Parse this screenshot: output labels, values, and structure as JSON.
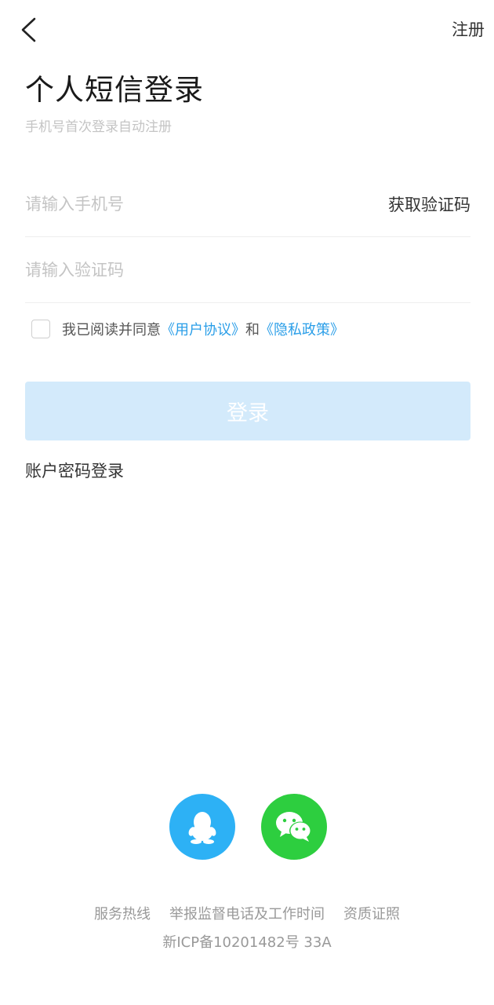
{
  "header": {
    "back_icon": "chevron-left-icon",
    "register_label": "注册"
  },
  "title": "个人短信登录",
  "subtitle": "手机号首次登录自动注册",
  "phone": {
    "placeholder": "请输入手机号",
    "value": "",
    "get_code_label": "获取验证码"
  },
  "code": {
    "placeholder": "请输入验证码",
    "value": ""
  },
  "agreement": {
    "checked": false,
    "prefix": "我已阅读并同意",
    "user_agreement": "《用户协议》",
    "and": "和",
    "privacy_policy": "《隐私政策》"
  },
  "login_label": "登录",
  "password_login_label": "账户密码登录",
  "social": {
    "qq_icon": "qq-icon",
    "wechat_icon": "wechat-icon"
  },
  "footer": {
    "links": [
      "服务热线",
      "举报监督电话及工作时间",
      "资质证照"
    ],
    "icp": "新ICP备10201482号 33A"
  },
  "colors": {
    "link": "#2a9ee8",
    "login_disabled": "#d3eafb",
    "qq": "#2db1f5",
    "wechat": "#2dce3f"
  }
}
